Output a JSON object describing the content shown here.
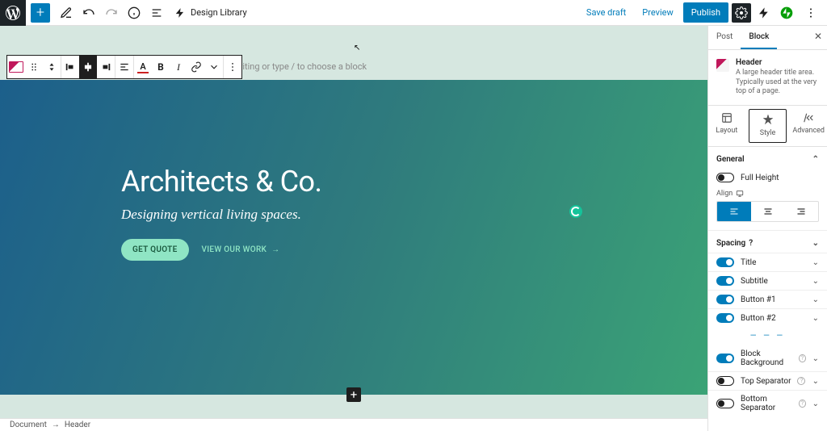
{
  "toolbar": {
    "design_library": "Design Library",
    "save_draft": "Save draft",
    "preview": "Preview",
    "publish": "Publish"
  },
  "canvas": {
    "placeholder": "t writing or type / to choose a block",
    "header": {
      "title": "Architects & Co.",
      "subtitle": "Designing vertical living spaces.",
      "btn1": "GET QUOTE",
      "btn2": "VIEW OUR WORK",
      "btn2_arrow": "→"
    }
  },
  "breadcrumb": {
    "doc": "Document",
    "arrow": "→",
    "block": "Header"
  },
  "sidebar": {
    "tabs": {
      "post": "Post",
      "block": "Block"
    },
    "card": {
      "title": "Header",
      "desc": "A large header title area. Typically used at the very top of a page."
    },
    "panels": {
      "layout": "Layout",
      "style": "Style",
      "advanced": "Advanced"
    },
    "general": {
      "title": "General",
      "full_height": "Full Height",
      "align": "Align"
    },
    "spacing": "Spacing",
    "rows": {
      "title": "Title",
      "subtitle": "Subtitle",
      "button1": "Button #1",
      "button2": "Button #2",
      "block_bg": "Block Background",
      "top_sep": "Top Separator",
      "bottom_sep": "Bottom Separator"
    }
  }
}
